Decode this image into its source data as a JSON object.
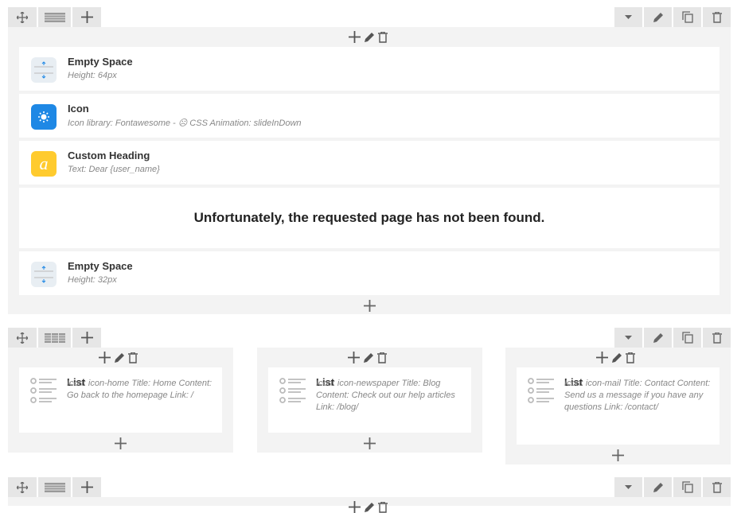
{
  "row1": {
    "elements": [
      {
        "title": "Empty Space",
        "subtitle": "Height: 64px",
        "icon": "empty-space-icon"
      },
      {
        "title": "Icon",
        "subtitle": "Icon library: Fontawesome - ☹ CSS Animation: slideInDown",
        "icon": "icon-element-icon"
      },
      {
        "title": "Custom Heading",
        "subtitle": "Text: Dear {user_name}",
        "icon": "custom-heading-icon"
      },
      {
        "heading": "Unfortunately, the requested page has not been found."
      },
      {
        "title": "Empty Space",
        "subtitle": "Height: 32px",
        "icon": "empty-space-icon"
      }
    ]
  },
  "row2": {
    "columns": [
      {
        "title": "List",
        "text": "Icon: icon-home  Title: Home  Content: Go back to the homepage  Link: /"
      },
      {
        "title": "List",
        "text": "Icon: icon-newspaper  Title: Blog  Content: Check out our help articles  Link: /blog/"
      },
      {
        "title": "List",
        "text": "Icon: icon-mail  Title: Contact  Content: Send us a message if you have any questions  Link: /contact/"
      }
    ]
  },
  "colors": {
    "accent_blue": "#1e88e5",
    "heading_yellow": "#ffcb2e",
    "panel": "#f3f3f3",
    "control": "#e6e6e6"
  }
}
